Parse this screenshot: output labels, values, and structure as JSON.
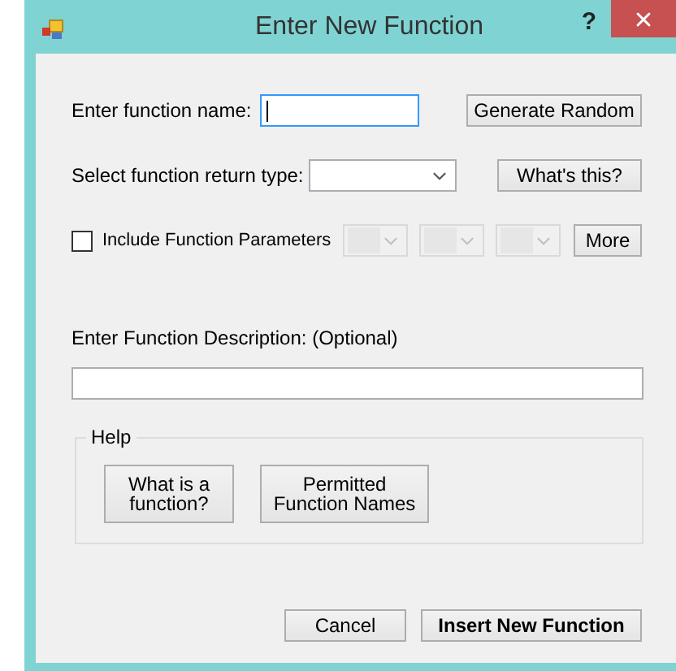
{
  "window": {
    "title": "Enter New Function",
    "help_button": "?"
  },
  "function_name": {
    "label": "Enter function name:",
    "focused": true
  },
  "generate_button": "Generate Random",
  "return_type": {
    "label": "Select function return type:"
  },
  "whats_this_button": "What's this?",
  "include_parameters": {
    "label": "Include Function Parameters",
    "checked": false
  },
  "parameter_combos": [
    {
      "disabled": true
    },
    {
      "disabled": true
    },
    {
      "disabled": true
    }
  ],
  "more_button": "More",
  "description": {
    "label": "Enter Function Description: (Optional)"
  },
  "help_group": {
    "title": "Help",
    "buttons": [
      "What is a function?",
      "Permitted Function Names"
    ]
  },
  "buttons": [
    {
      "label": "Cancel",
      "kind": "normal"
    },
    {
      "label": "Insert New Function",
      "kind": "default"
    }
  ]
}
